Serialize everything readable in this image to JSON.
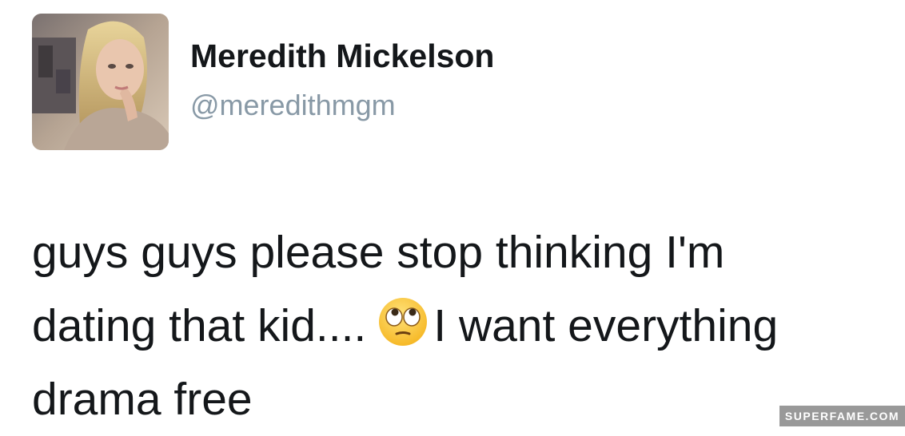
{
  "tweet": {
    "author_name": "Meredith Mickelson",
    "handle": "@meredithmgm",
    "avatar_icon": "profile-photo",
    "text_line1": "guys guys please stop thinking I'm",
    "text_line2a": "dating that kid....",
    "emoji": "face-with-rolling-eyes",
    "text_line2b": "I want everything",
    "text_line3": "drama free"
  },
  "watermark": {
    "label": "SUPERFAME.COM"
  },
  "colors": {
    "name": "#14171a",
    "handle": "#8899a6",
    "text": "#14171a",
    "watermark_bg": "#999999"
  }
}
